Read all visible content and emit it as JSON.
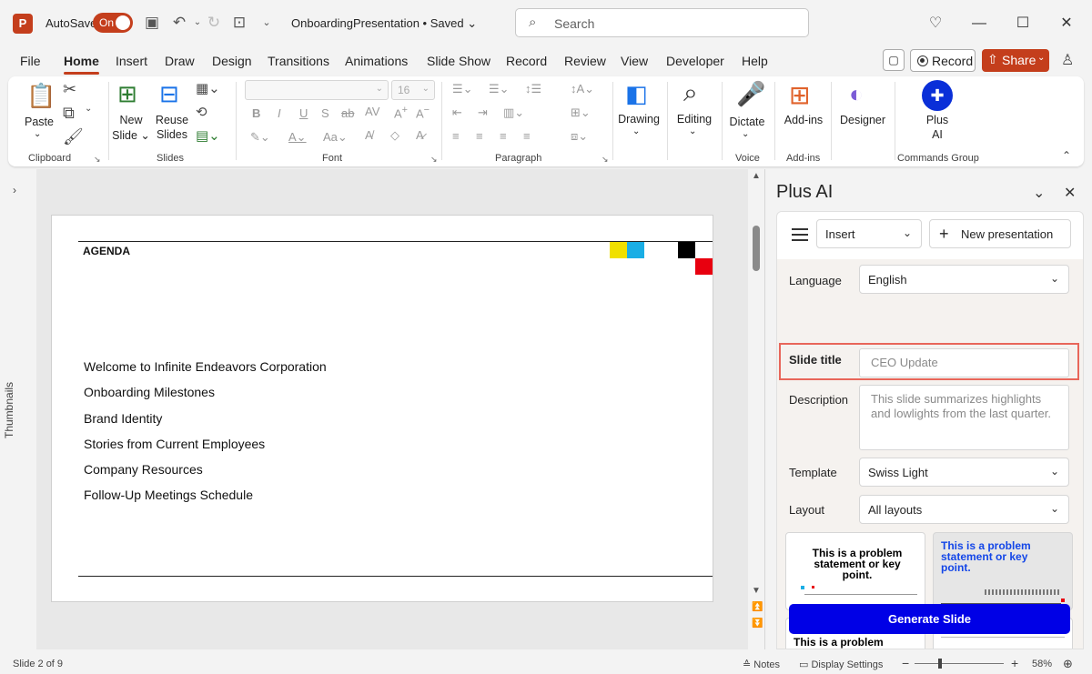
{
  "titlebar": {
    "app_logo": "P",
    "autosave_label": "AutoSave",
    "autosave_state": "On",
    "doc_title": "OnboardingPresentation • Saved",
    "search_placeholder": "Search"
  },
  "tabs": [
    "File",
    "Home",
    "Insert",
    "Draw",
    "Design",
    "Transitions",
    "Animations",
    "Slide Show",
    "Record",
    "Review",
    "View",
    "Developer",
    "Help"
  ],
  "active_tab": "Home",
  "actions": {
    "record": "Record",
    "share": "Share"
  },
  "ribbon": {
    "paste": "Paste",
    "clipboard": "Clipboard",
    "new_slide_1": "New",
    "new_slide_2": "Slide",
    "reuse_1": "Reuse",
    "reuse_2": "Slides",
    "slides": "Slides",
    "font_size": "16",
    "font": "Font",
    "paragraph": "Paragraph",
    "drawing": "Drawing",
    "editing": "Editing",
    "dictate": "Dictate",
    "voice": "Voice",
    "addins_btn": "Add-ins",
    "addins_group": "Add-ins",
    "designer": "Designer",
    "plus_1": "Plus",
    "plus_2": "AI",
    "commands_group": "Commands Group",
    "bold": "B",
    "italic": "I",
    "underline": "U",
    "strike": "S",
    "ab": "ab",
    "av": "AV",
    "aa": "Aa"
  },
  "thumbnails_label": "Thumbnails",
  "slide": {
    "heading": "AGENDA",
    "items": [
      "Welcome to Infinite Endeavors Corporation",
      "Onboarding Milestones",
      "Brand Identity",
      "Stories from Current Employees",
      "Company Resources",
      "Follow-Up Meetings Schedule"
    ],
    "colors": [
      "#f0e000",
      "#1aaee5",
      "#000000",
      "#e8000f"
    ]
  },
  "pane": {
    "title": "Plus AI",
    "mode": "Insert",
    "new_presentation": "New presentation",
    "language_label": "Language",
    "language_value": "English",
    "slide_title_label": "Slide title",
    "slide_title_placeholder": "CEO Update",
    "description_label": "Description",
    "description_placeholder": "This slide summarizes highlights and lowlights from the last quarter.",
    "template_label": "Template",
    "template_value": "Swiss Light",
    "layout_label": "Layout",
    "layout_value": "All layouts",
    "card1_title": "This is a problem statement or key point.",
    "card2_title": "This is a problem statement or key point.",
    "card3_title": "This is a problem statement",
    "generate": "Generate Slide"
  },
  "status": {
    "slide_info": "Slide 2 of 9",
    "notes": "Notes",
    "display_settings": "Display Settings",
    "zoom": "58%"
  }
}
